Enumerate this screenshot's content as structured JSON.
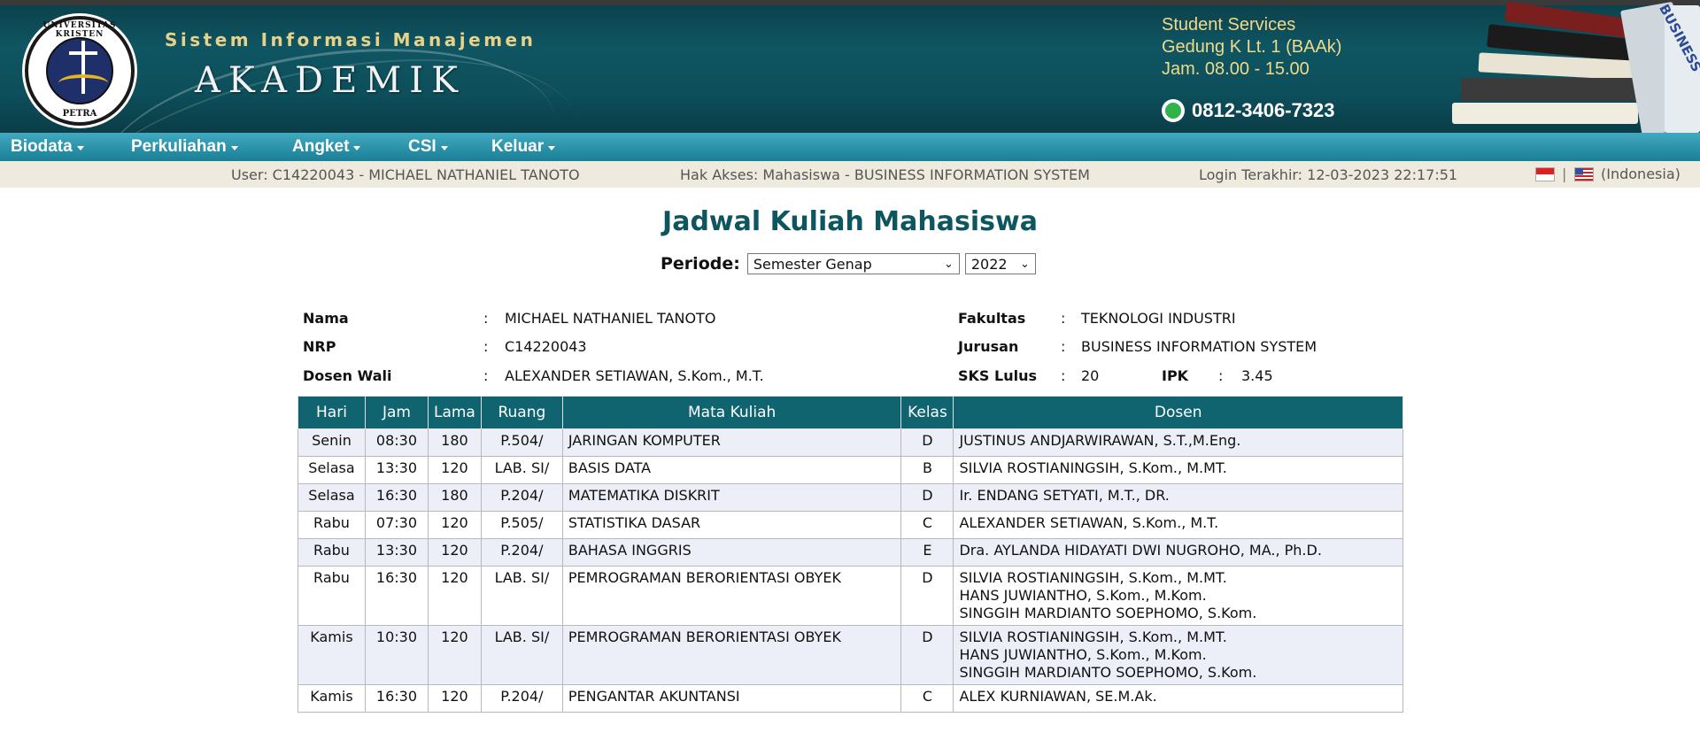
{
  "header": {
    "logo_ring_text": "UNIVERSITAS KRISTEN",
    "logo_bottom_text": "PETRA",
    "system_title": "Sistem Informasi Manajemen",
    "system_name": "AKADEMIK",
    "services": [
      "Student Services",
      "Gedung K Lt. 1 (BAAk)",
      "Jam. 08.00 - 15.00"
    ],
    "phone": "0812-3406-7323",
    "book_spine_text": "BUSINESS"
  },
  "menu": [
    {
      "label": "Biodata"
    },
    {
      "label": "Perkuliahan"
    },
    {
      "label": "Angket"
    },
    {
      "label": "CSI"
    },
    {
      "label": "Keluar"
    }
  ],
  "infobar": {
    "user": "User: C14220043 - MICHAEL NATHANIEL TANOTO",
    "access": "Hak Akses: Mahasiswa - BUSINESS INFORMATION SYSTEM",
    "last_login": "Login Terakhir: 12-03-2023 22:17:51",
    "separator": "|",
    "language": "(Indonesia)"
  },
  "page": {
    "title": "Jadwal Kuliah Mahasiswa",
    "periode_label": "Periode:",
    "semester_selected": "Semester Genap",
    "year_selected": "2022"
  },
  "profile": {
    "nama_label": "Nama",
    "nama": "MICHAEL NATHANIEL TANOTO",
    "nrp_label": "NRP",
    "nrp": "C14220043",
    "wali_label": "Dosen Wali",
    "wali": "ALEXANDER SETIAWAN, S.Kom., M.T.",
    "fakultas_label": "Fakultas",
    "fakultas": "TEKNOLOGI INDUSTRI",
    "jurusan_label": "Jurusan",
    "jurusan": "BUSINESS INFORMATION SYSTEM",
    "sks_label": "SKS Lulus",
    "sks": "20",
    "ipk_label": "IPK",
    "ipk": "3.45",
    "colon": ":"
  },
  "table": {
    "headers": [
      "Hari",
      "Jam",
      "Lama",
      "Ruang",
      "Mata Kuliah",
      "Kelas",
      "Dosen"
    ],
    "rows": [
      {
        "hari": "Senin",
        "jam": "08:30",
        "lama": "180",
        "ruang": "P.504/",
        "mk": "JARINGAN KOMPUTER",
        "kelas": "D",
        "dosen": [
          "JUSTINUS ANDJARWIRAWAN, S.T.,M.Eng."
        ]
      },
      {
        "hari": "Selasa",
        "jam": "13:30",
        "lama": "120",
        "ruang": "LAB. SI/",
        "mk": "BASIS DATA",
        "kelas": "B",
        "dosen": [
          "SILVIA ROSTIANINGSIH, S.Kom., M.MT."
        ]
      },
      {
        "hari": "Selasa",
        "jam": "16:30",
        "lama": "180",
        "ruang": "P.204/",
        "mk": "MATEMATIKA DISKRIT",
        "kelas": "D",
        "dosen": [
          "Ir. ENDANG SETYATI, M.T., DR."
        ]
      },
      {
        "hari": "Rabu",
        "jam": "07:30",
        "lama": "120",
        "ruang": "P.505/",
        "mk": "STATISTIKA DASAR",
        "kelas": "C",
        "dosen": [
          "ALEXANDER SETIAWAN, S.Kom., M.T."
        ]
      },
      {
        "hari": "Rabu",
        "jam": "13:30",
        "lama": "120",
        "ruang": "P.204/",
        "mk": "BAHASA INGGRIS",
        "kelas": "E",
        "dosen": [
          "Dra. AYLANDA HIDAYATI DWI NUGROHO, MA., Ph.D."
        ]
      },
      {
        "hari": "Rabu",
        "jam": "16:30",
        "lama": "120",
        "ruang": "LAB. SI/",
        "mk": "PEMROGRAMAN BERORIENTASI OBYEK",
        "kelas": "D",
        "dosen": [
          "SILVIA ROSTIANINGSIH, S.Kom., M.MT.",
          "HANS JUWIANTHO, S.Kom., M.Kom.",
          "SINGGIH MARDIANTO SOEPHOMO, S.Kom."
        ]
      },
      {
        "hari": "Kamis",
        "jam": "10:30",
        "lama": "120",
        "ruang": "LAB. SI/",
        "mk": "PEMROGRAMAN BERORIENTASI OBYEK",
        "kelas": "D",
        "dosen": [
          "SILVIA ROSTIANINGSIH, S.Kom., M.MT.",
          "HANS JUWIANTHO, S.Kom., M.Kom.",
          "SINGGIH MARDIANTO SOEPHOMO, S.Kom."
        ]
      },
      {
        "hari": "Kamis",
        "jam": "16:30",
        "lama": "120",
        "ruang": "P.204/",
        "mk": "PENGANTAR AKUNTANSI",
        "kelas": "C",
        "dosen": [
          "ALEX KURNIAWAN, SE.M.Ak."
        ]
      }
    ]
  },
  "colors": {
    "banner": "#0f5562",
    "menubar": "#1a7f96",
    "title": "#0d5660",
    "table_header": "#0f6470",
    "row_alt": "#eceff7",
    "infobar": "#eeebde"
  }
}
